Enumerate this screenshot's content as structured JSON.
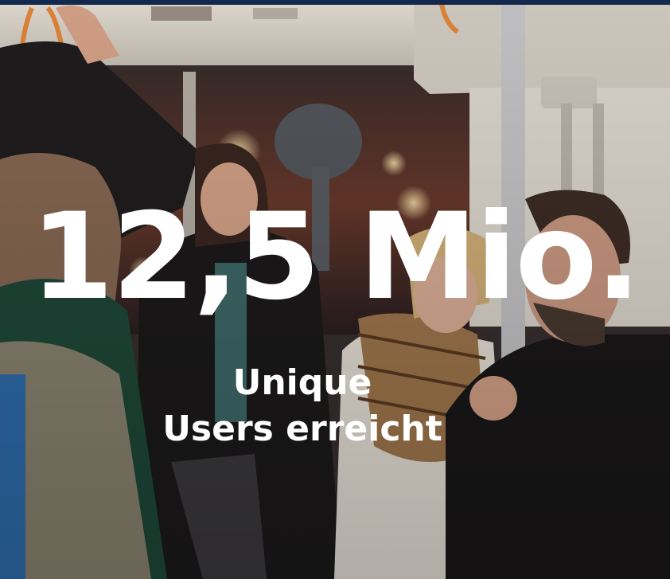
{
  "photo": {
    "scene": "bus-interior",
    "colors": {
      "ceiling": "#dcd6cc",
      "window_night": "#2a2226",
      "coat_dark": "#1c1a1b",
      "scarf_green": "#1f4a3a",
      "scarf_plaid": "#a47a4e",
      "skin": "#d9a58a",
      "pole": "#c9c9cb",
      "strap_orange": "#e5893a"
    }
  },
  "overlay": {
    "headline": "12,5 Mio.",
    "subline_line1": "Unique",
    "subline_line2": "Users erreicht",
    "text_color": "#ffffff",
    "accent_bar": "#13284d"
  }
}
